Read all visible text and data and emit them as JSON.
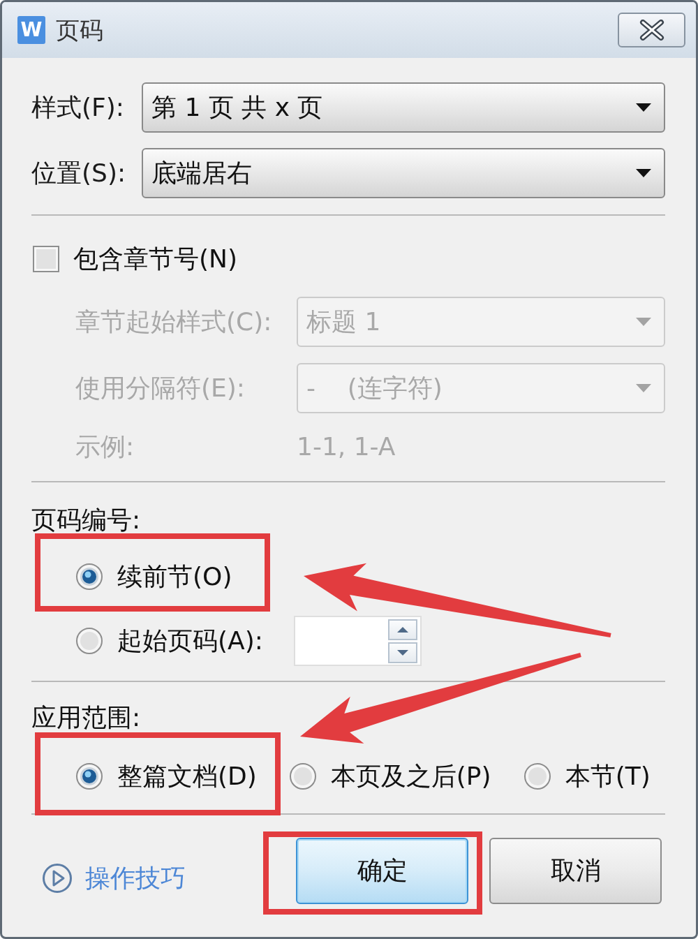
{
  "window": {
    "app_icon": "W",
    "title": "页码"
  },
  "format_fields": [
    {
      "label": "样式(F):",
      "value": "第 1 页 共 x 页",
      "disabled": false
    },
    {
      "label": "位置(S):",
      "value": "底端居右",
      "disabled": false
    }
  ],
  "chapter": {
    "checkbox": {
      "label": "包含章节号(N)",
      "checked": false
    },
    "fields": [
      {
        "kind": "dropdown",
        "label": "章节起始样式(C):",
        "value": "标题 1",
        "disabled": true
      },
      {
        "kind": "dropdown",
        "label": "使用分隔符(E):",
        "value": "-    (连字符)",
        "disabled": true
      },
      {
        "kind": "example",
        "label": "示例:",
        "value": "1-1, 1-A",
        "disabled": true
      }
    ]
  },
  "numbering": {
    "heading": "页码编号:",
    "arrow": true,
    "options": [
      {
        "kind": "radio",
        "label": "续前节(O)",
        "selected": true,
        "highlighted": true
      },
      {
        "kind": "radio_spin",
        "label": "起始页码(A):",
        "selected": false,
        "highlighted": false
      }
    ]
  },
  "apply_to": {
    "heading": "应用范围:",
    "arrow": true,
    "options": [
      {
        "label": "整篇文档(D)",
        "selected": true,
        "highlighted": true
      },
      {
        "label": "本页及之后(P)",
        "selected": false,
        "highlighted": false
      },
      {
        "label": "本节(T)",
        "selected": false,
        "highlighted": false
      }
    ]
  },
  "help_link": {
    "label": "操作技巧"
  },
  "buttons": [
    {
      "label": "确定",
      "default": true,
      "highlighted": true
    },
    {
      "label": "取消",
      "default": false,
      "highlighted": false
    }
  ]
}
